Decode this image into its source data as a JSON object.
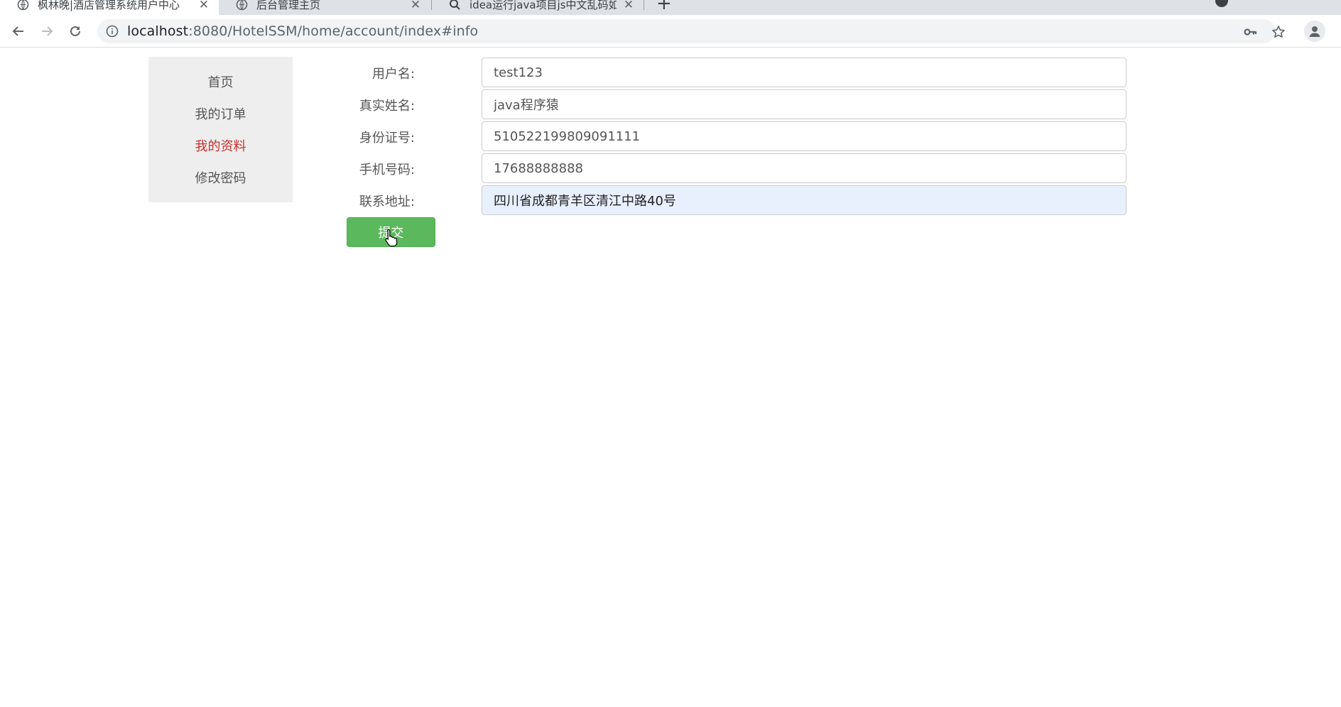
{
  "browser": {
    "tabs": [
      {
        "title": "枫林晚|酒店管理系统用户中心",
        "active": true
      },
      {
        "title": "后台管理主页",
        "active": false
      },
      {
        "title": "idea运行java项目js中文乱码如何解决",
        "active": false
      }
    ],
    "url_host": "localhost",
    "url_rest": ":8080/HotelSSM/home/account/index#info",
    "icons": {
      "back": "back-arrow-icon",
      "forward": "forward-arrow-icon",
      "reload": "reload-icon",
      "info": "info-icon",
      "key": "key-icon",
      "bookmark": "star-icon",
      "profile": "profile-icon",
      "close": "close-icon",
      "new_tab": "plus-icon"
    }
  },
  "sidebar": {
    "items": [
      {
        "label": "首页",
        "active": false
      },
      {
        "label": "我的订单",
        "active": false
      },
      {
        "label": "我的资料",
        "active": true
      },
      {
        "label": "修改密码",
        "active": false
      }
    ]
  },
  "form": {
    "fields": [
      {
        "label": "用户名:",
        "value": "test123"
      },
      {
        "label": "真实姓名:",
        "value": "java程序猿"
      },
      {
        "label": "身份证号:",
        "value": "510522199809091111"
      },
      {
        "label": "手机号码:",
        "value": "17688888888"
      },
      {
        "label": "联系地址:",
        "value": "四川省成都青羊区清江中路40号"
      }
    ],
    "submit_label": "提交"
  },
  "colors": {
    "accent_active": "#c9302c",
    "submit_bg": "#5cb85c",
    "autofill_bg": "#e8f0fe"
  }
}
